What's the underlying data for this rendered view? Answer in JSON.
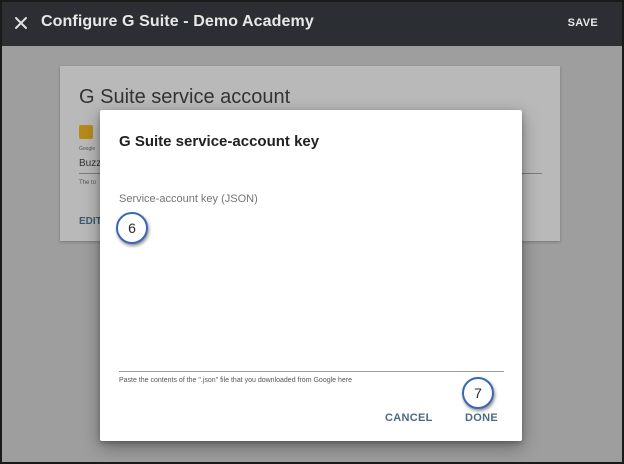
{
  "topbar": {
    "title": "Configure G Suite - Demo Academy",
    "save_label": "SAVE",
    "close_icon": "close-icon"
  },
  "background_card": {
    "title": "G Suite service account",
    "field_caption": "Google",
    "field_value": "Buzz",
    "field_help": "The to",
    "edit_label": "EDIT"
  },
  "dialog": {
    "title": "G Suite service-account key",
    "field_label": "Service-account key (JSON)",
    "field_value": "",
    "help_text": "Paste the contents of the \".json\" file that you downloaded from Google here",
    "cancel_label": "CANCEL",
    "done_label": "DONE"
  },
  "callouts": {
    "step_6": "6",
    "step_7": "7"
  },
  "colors": {
    "topbar": "#2b2f33",
    "accent_button": "#4a6b80",
    "checkbox": "#b68a1c",
    "callout_border": "#3a67b8"
  }
}
